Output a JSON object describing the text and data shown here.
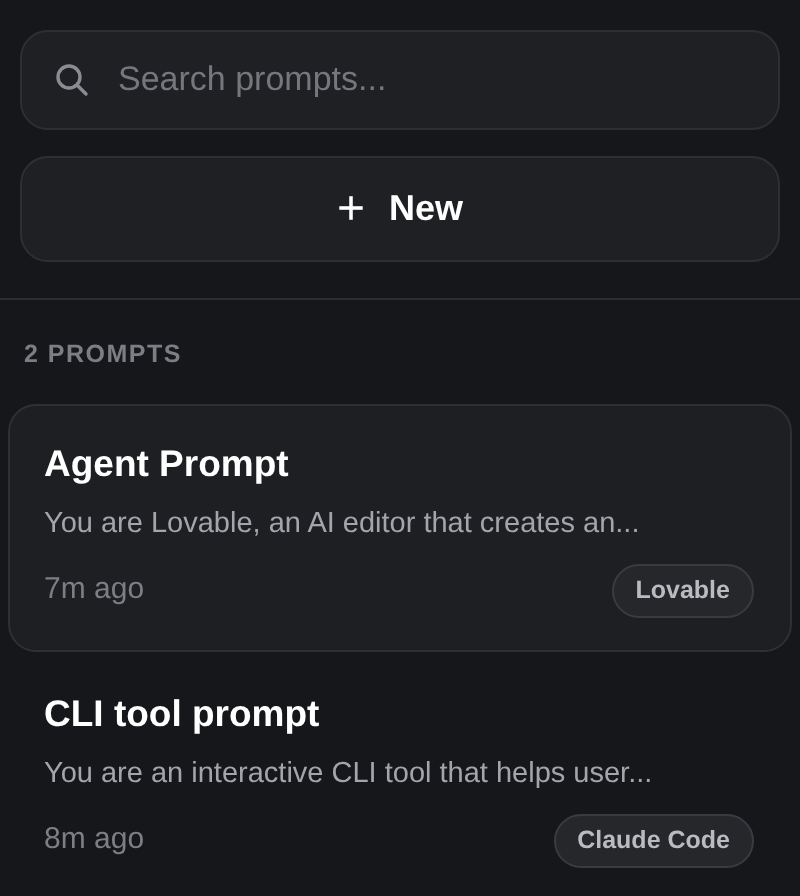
{
  "search": {
    "placeholder": "Search prompts..."
  },
  "new_button": {
    "icon": "+",
    "label": "New"
  },
  "count_label": "2 PROMPTS",
  "prompts": [
    {
      "title": "Agent Prompt",
      "preview": "You are Lovable, an AI editor that creates an...",
      "time": "7m ago",
      "tag": "Lovable",
      "selected": true
    },
    {
      "title": "CLI tool prompt",
      "preview": "You are an interactive CLI tool that helps user...",
      "time": "8m ago",
      "tag": "Claude Code",
      "selected": false
    }
  ]
}
